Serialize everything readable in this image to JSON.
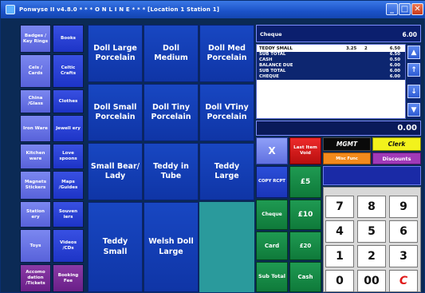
{
  "window": {
    "title": "Ponwyse II v4.8.0 * * * O N   L I N E * * *  [Location 1 Station 1]"
  },
  "title_buttons": {
    "minimize": "_",
    "maximize": "□",
    "close": "✕"
  },
  "categories_col1": [
    {
      "label": "Badges / Key Rings"
    },
    {
      "label": "Cels / Cards"
    },
    {
      "label": "China /Glass"
    },
    {
      "label": "Iron Ware"
    },
    {
      "label": "Kitchen ware"
    },
    {
      "label": "Magnets Stickers"
    },
    {
      "label": "Station ery"
    },
    {
      "label": "Toys"
    },
    {
      "label": "Accomo dation /Tickets"
    }
  ],
  "categories_col2": [
    {
      "label": "Books"
    },
    {
      "label": "Celtic Crafts"
    },
    {
      "label": "Clothes"
    },
    {
      "label": "Jewell ery"
    },
    {
      "label": "Love spoons"
    },
    {
      "label": "Maps /Guides"
    },
    {
      "label": "Souven iers"
    },
    {
      "label": "Videos /CDs"
    },
    {
      "label": "Booking Fee"
    }
  ],
  "products": [
    {
      "label": "Doll Large Porcelain"
    },
    {
      "label": "Doll Medium"
    },
    {
      "label": "Doll Med Porcelain"
    },
    {
      "label": "Doll Small Porcelain"
    },
    {
      "label": "Doll Tiny Porcelain"
    },
    {
      "label": "Doll VTiny Porcelain"
    },
    {
      "label": "Small Bear/ Lady"
    },
    {
      "label": "Teddy in Tube"
    },
    {
      "label": "Teddy Large"
    },
    {
      "label": "Teddy Small"
    },
    {
      "label": "Welsh Doll Large"
    }
  ],
  "tender_header": {
    "label": "Cheque",
    "amount": "6.00"
  },
  "receipt": {
    "lines": [
      {
        "name": "TEDDY SMALL",
        "qty1": "3.25",
        "qty2": "2",
        "total": "6.50"
      },
      {
        "name": "  SUB TOTAL",
        "qty1": "",
        "qty2": "",
        "total": "6.50"
      },
      {
        "name": "  CASH",
        "qty1": "",
        "qty2": "",
        "total": "0.50"
      },
      {
        "name": "  BALANCE DUE",
        "qty1": "",
        "qty2": "",
        "total": "6.00"
      },
      {
        "name": "  SUB TOTAL",
        "qty1": "",
        "qty2": "",
        "total": "6.00"
      },
      {
        "name": "  CHEQUE",
        "qty1": "",
        "qty2": "",
        "total": "6.00"
      }
    ]
  },
  "scroll_buttons": {
    "top": "▲",
    "up": "↑",
    "down": "↓",
    "bottom": "▼"
  },
  "total_display": "0.00",
  "function_keys": {
    "x": "X",
    "last_item_void": "Last Item Void",
    "mgmt": "MGMT",
    "clerk": "Clerk",
    "misc_func": "Misc Func",
    "discounts": "Discounts",
    "copy_receipt": "COPY RCPT"
  },
  "tender_keys": {
    "five": "£5",
    "cheque": "Cheque",
    "ten": "£10",
    "card": "Card",
    "twenty": "£20",
    "sub_total": "Sub Total",
    "cash": "Cash"
  },
  "numpad": {
    "keys": [
      "7",
      "8",
      "9",
      "4",
      "5",
      "6",
      "1",
      "2",
      "3",
      "0",
      "00",
      "C"
    ]
  },
  "colors": {
    "title_bar": "#1b52c8",
    "product_button": "#1847c2",
    "tender_green": "#1f9a52",
    "void_red": "#ee2a2a",
    "clerk_yellow": "#f2f21c",
    "misc_orange": "#f28a1c",
    "discount_purple": "#a03ab8"
  }
}
